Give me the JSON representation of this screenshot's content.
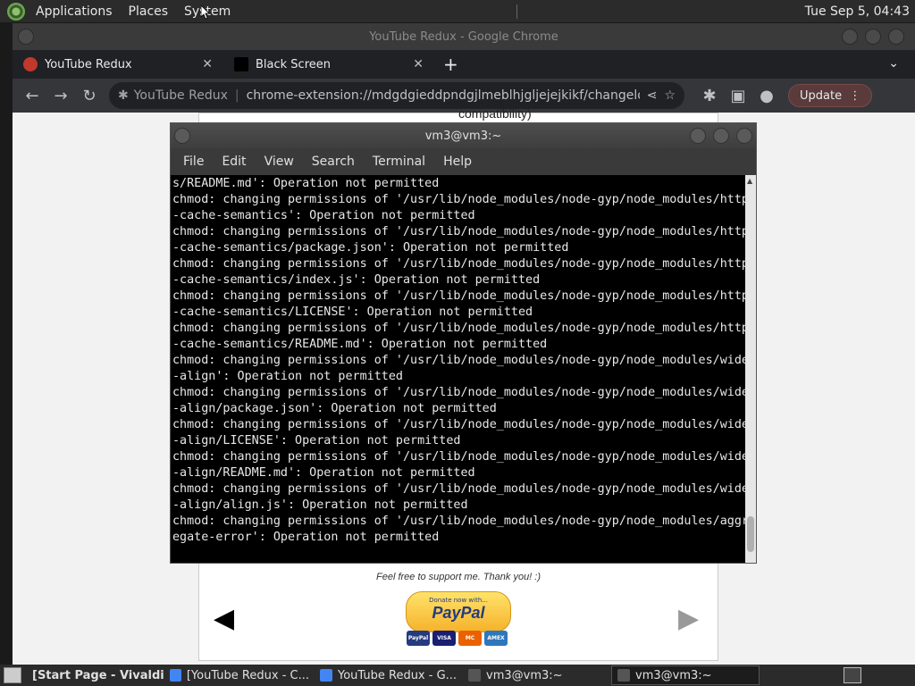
{
  "top_panel": {
    "menus": [
      "Applications",
      "Places",
      "System"
    ],
    "clock": "Tue Sep  5, 04:43"
  },
  "chrome": {
    "window_title": "YouTube Redux - Google Chrome",
    "tabs": [
      {
        "label": "YouTube Redux",
        "close": "✕"
      },
      {
        "label": "Black Screen",
        "close": "✕"
      }
    ],
    "new_tab": "+",
    "overflow": "⌄",
    "omnibox": {
      "page_title": "YouTube Redux",
      "url": "chrome-extension://mdgdgieddpndgjlmeblhjgljejejkikf/changelog.html#install"
    },
    "update_label": "Update"
  },
  "page": {
    "cut_text": "compatibility)",
    "support_text": "Feel free to support me. Thank you! :)",
    "paypal_small": "Donate now with...",
    "paypal_big": "PayPal",
    "cards": [
      "PayPal",
      "VISA",
      "MC",
      "AMEX"
    ]
  },
  "terminal": {
    "title": "vm3@vm3:~",
    "menus": [
      "File",
      "Edit",
      "View",
      "Search",
      "Terminal",
      "Help"
    ],
    "lines": [
      "s/README.md': Operation not permitted",
      "chmod: changing permissions of '/usr/lib/node_modules/node-gyp/node_modules/http",
      "-cache-semantics': Operation not permitted",
      "chmod: changing permissions of '/usr/lib/node_modules/node-gyp/node_modules/http",
      "-cache-semantics/package.json': Operation not permitted",
      "chmod: changing permissions of '/usr/lib/node_modules/node-gyp/node_modules/http",
      "-cache-semantics/index.js': Operation not permitted",
      "chmod: changing permissions of '/usr/lib/node_modules/node-gyp/node_modules/http",
      "-cache-semantics/LICENSE': Operation not permitted",
      "chmod: changing permissions of '/usr/lib/node_modules/node-gyp/node_modules/http",
      "-cache-semantics/README.md': Operation not permitted",
      "chmod: changing permissions of '/usr/lib/node_modules/node-gyp/node_modules/wide",
      "-align': Operation not permitted",
      "chmod: changing permissions of '/usr/lib/node_modules/node-gyp/node_modules/wide",
      "-align/package.json': Operation not permitted",
      "chmod: changing permissions of '/usr/lib/node_modules/node-gyp/node_modules/wide",
      "-align/LICENSE': Operation not permitted",
      "chmod: changing permissions of '/usr/lib/node_modules/node-gyp/node_modules/wide",
      "-align/README.md': Operation not permitted",
      "chmod: changing permissions of '/usr/lib/node_modules/node-gyp/node_modules/wide",
      "-align/align.js': Operation not permitted",
      "chmod: changing permissions of '/usr/lib/node_modules/node-gyp/node_modules/aggr",
      "egate-error': Operation not permitted"
    ]
  },
  "taskbar": {
    "items": [
      {
        "label": "[Start Page - Vivaldi]",
        "icon": "vivaldi-icon",
        "color": "#c0392b"
      },
      {
        "label": "[YouTube Redux - C...",
        "icon": "chrome-icon",
        "color": "#4285f4"
      },
      {
        "label": "YouTube Redux - G...",
        "icon": "chrome-icon",
        "color": "#4285f4"
      },
      {
        "label": "vm3@vm3:~",
        "icon": "terminal-icon",
        "color": "#555555"
      },
      {
        "label": "vm3@vm3:~",
        "icon": "terminal-icon",
        "color": "#555555"
      }
    ]
  }
}
